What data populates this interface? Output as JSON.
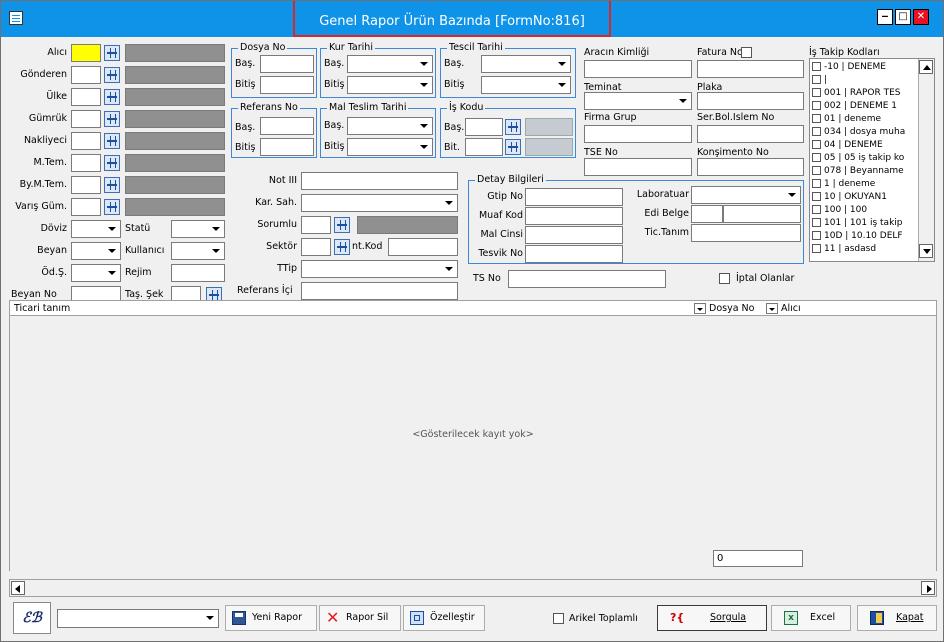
{
  "window": {
    "title": "Genel Rapor Ürün Bazında [FormNo:816]"
  },
  "left_labels": {
    "alici": "Alıcı",
    "gonderen": "Gönderen",
    "ulke": "Ülke",
    "gumruk": "Gümrük",
    "nakliyeci": "Nakliyeci",
    "mtem": "M.Tem.",
    "bymtem": "By.M.Tem.",
    "varis": "Varış Güm.",
    "doviz": "Döviz",
    "beyan": "Beyan",
    "odsek": "Öd.Ş.",
    "beyanno": "Beyan No",
    "statu": "Statü",
    "kullanici": "Kullanıcı",
    "rejim": "Rejim",
    "tassek": "Taş. Şek"
  },
  "groups": {
    "dosya_no": "Dosya No",
    "kur_tarihi": "Kur Tarihi",
    "tescil_tarihi": "Tescil Tarihi",
    "referans_no": "Referans No",
    "mal_teslim": "Mal Teslim Tarihi",
    "is_kodu": "İş Kodu",
    "detay": "Detay Bilgileri"
  },
  "range_labels": {
    "bas": "Baş.",
    "bitis": "Bitiş",
    "bit": "Bit."
  },
  "mid_labels": {
    "not3": "Not III",
    "karsah": "Kar. Sah.",
    "sorumlu": "Sorumlu",
    "sektor": "Sektör",
    "intkod": "nt.Kod",
    "ttip": "TTip",
    "refici": "Referans İçi",
    "tsno": "TS No"
  },
  "detay_labels": {
    "gtip": "Gtip No",
    "muaf": "Muaf Kod",
    "malcinsi": "Mal Cinsi",
    "tesvik": "Tesvik No",
    "laboratuar": "Laboratuar",
    "edibelge": "Edi Belge",
    "tictanim": "Tic.Tanım"
  },
  "right_labels": {
    "arac": "Aracın Kimliği",
    "fatura": "Fatura No",
    "teminat": "Teminat",
    "plaka": "Plaka",
    "firmagrup": "Firma Grup",
    "serbol": "Ser.Bol.Islem No",
    "tse": "TSE No",
    "konsimento": "Konşimento No",
    "iptal": "İptal Olanlar"
  },
  "is_takip": {
    "title": "İş Takip Kodları",
    "items": [
      "-10 | DENEME",
      "|",
      "001 | RAPOR TES",
      "002 | DENEME 1",
      "01 | deneme",
      "034 | dosya muha",
      "04 | DENEME",
      "05 | 05 iş takip ko",
      "078 | Beyanname",
      "1 | deneme",
      "10 | OKUYAN1",
      "100 | 100",
      "101 | 101 iş takip",
      "10D | 10.10 DELF",
      "11 | asdasd"
    ]
  },
  "grid": {
    "col_ticari": "Ticari tanım",
    "col_dosya": "Dosya No",
    "col_alici": "Alıcı",
    "empty": "<Gösterilecek kayıt yok>",
    "count": "0"
  },
  "toolbar": {
    "yeni": "Yeni Rapor",
    "sil": "Rapor Sil",
    "ozellestir": "Özelleştir",
    "artikel": "Arikel Toplamlı",
    "sorgula": "Sorgula",
    "excel": "Excel",
    "kapat": "Kapat"
  },
  "colors": {
    "titlebar": "#0f93e8",
    "highlight": "#d9262b",
    "selected_field": "#ffff00"
  }
}
